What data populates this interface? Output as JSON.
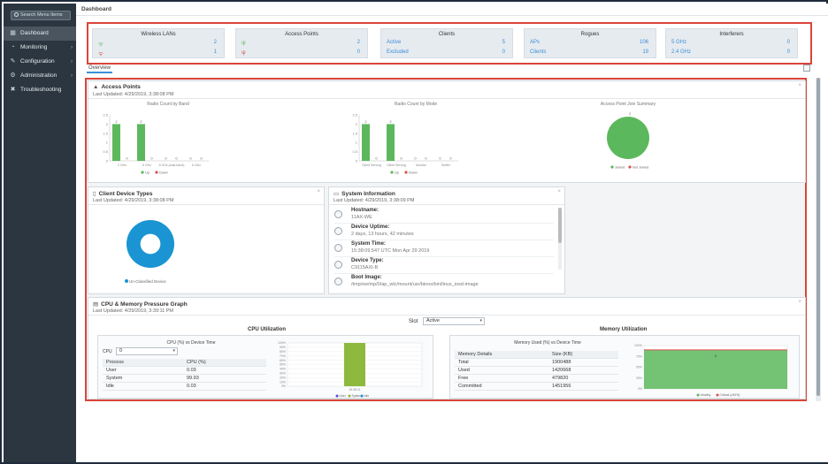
{
  "sidebar": {
    "search_placeholder": "Search Menu Items",
    "items": [
      {
        "label": "Dashboard",
        "icon": "dashboard-icon",
        "active": true
      },
      {
        "label": "Monitoring",
        "icon": "monitoring-icon",
        "chevron": "›"
      },
      {
        "label": "Configuration",
        "icon": "configuration-icon",
        "chevron": "›"
      },
      {
        "label": "Administration",
        "icon": "administration-icon",
        "chevron": "›"
      },
      {
        "label": "Troubleshooting",
        "icon": "troubleshooting-icon"
      }
    ]
  },
  "header": {
    "title": "Dashboard"
  },
  "summary": [
    {
      "title": "Wireless LANs",
      "rows": [
        {
          "label": "",
          "value": "2",
          "icon": "wifi-up-icon"
        },
        {
          "label": "",
          "value": "1",
          "icon": "wifi-down-icon"
        }
      ]
    },
    {
      "title": "Access Points",
      "rows": [
        {
          "label": "",
          "value": "2",
          "icon": "ap-up-icon"
        },
        {
          "label": "",
          "value": "0",
          "icon": "ap-down-icon"
        }
      ]
    },
    {
      "title": "Clients",
      "rows": [
        {
          "label": "Active",
          "value": "5"
        },
        {
          "label": "Excluded",
          "value": "0"
        }
      ]
    },
    {
      "title": "Rogues",
      "rows": [
        {
          "label": "APs",
          "value": "106"
        },
        {
          "label": "Clients",
          "value": "19"
        }
      ]
    },
    {
      "title": "Interferers",
      "rows": [
        {
          "label": "5 GHz",
          "value": "0"
        },
        {
          "label": "2.4 GHz",
          "value": "0"
        }
      ]
    }
  ],
  "tabs": [
    {
      "label": "Overview"
    }
  ],
  "access_points": {
    "title": "Access Points",
    "updated": "Last Updated: 4/29/2019, 3:38:08 PM",
    "radio_by_band": {
      "title": "Radio Count by Band"
    },
    "radio_by_mode": {
      "title": "Radio Count by Mode"
    },
    "join_summary": {
      "title": "Access Point Join Summary",
      "legend": [
        "Joined",
        "Not Joined"
      ]
    }
  },
  "client_types": {
    "title": "Client Device Types",
    "updated": "Last Updated: 4/29/2019, 3:38:08 PM",
    "legend": "Un-Classified Device"
  },
  "system_info": {
    "title": "System Information",
    "updated": "Last Updated: 4/29/2019, 3:38:09 PM",
    "rows": [
      {
        "label": "Hostname:",
        "value": "11AX-WE"
      },
      {
        "label": "Device Uptime:",
        "value": "2 days, 13 hours, 42 minutes"
      },
      {
        "label": "System Time:",
        "value": "15:38:09.547 UTC Mon Apr 29 2019"
      },
      {
        "label": "Device Type:",
        "value": "C9115AXI-B"
      },
      {
        "label": "Boot Image:",
        "value": "/tmp/sw/mp/0/ap_wlc/mount/usr/binos/bin/linux_iosd-image"
      }
    ]
  },
  "cpu_mem": {
    "title": "CPU & Memory Pressure Graph",
    "updated": "Last Updated: 4/29/2019, 3:39:11 PM",
    "slot_label": "Slot",
    "slot_value": "Active",
    "cpu": {
      "heading": "CPU Utilization",
      "chart_title": "CPU (%) vs Device Time",
      "cpu_label": "CPU",
      "cpu_value": "0",
      "columns": [
        "Process",
        "CPU (%)"
      ],
      "rows": [
        [
          "User",
          "0.03"
        ],
        [
          "System",
          "99.93"
        ],
        [
          "Idle",
          "0.03"
        ]
      ],
      "x_tick": "15:38:11",
      "legend": [
        "User",
        "System",
        "Idle"
      ]
    },
    "mem": {
      "heading": "Memory Utilization",
      "chart_title": "Memory Used (%) vs Device Time",
      "columns": [
        "Memory Details",
        "Size (KB)"
      ],
      "rows": [
        [
          "Total",
          "1900488"
        ],
        [
          "Used",
          "1420668"
        ],
        [
          "Free",
          "479820"
        ],
        [
          "Committed",
          "1451956"
        ]
      ],
      "legend": [
        "Healthy",
        "Critical (≥90%)"
      ]
    }
  },
  "chart_data": [
    {
      "type": "bar",
      "title": "Radio Count by Band",
      "categories": [
        "2 GHz",
        "5 GHz",
        "5 GHz (dual-band)",
        "6 GHz"
      ],
      "series": [
        {
          "name": "Up",
          "values": [
            2,
            2,
            0,
            0
          ],
          "color": "#5cb85c"
        },
        {
          "name": "Down",
          "values": [
            0,
            0,
            0,
            0
          ],
          "color": "#d9534f"
        }
      ],
      "ylim": [
        0,
        2.5
      ],
      "yticks": [
        0,
        0.5,
        1,
        1.5,
        2,
        2.5
      ]
    },
    {
      "type": "bar",
      "title": "Radio Count by Mode",
      "categories": [
        "Client Serving",
        "Client Serving",
        "Monitor",
        "Sniffer"
      ],
      "series": [
        {
          "name": "Up",
          "values": [
            2,
            2,
            0,
            0
          ],
          "color": "#5cb85c"
        },
        {
          "name": "Down",
          "values": [
            0,
            0,
            0,
            0
          ],
          "color": "#d9534f"
        }
      ],
      "ylim": [
        0,
        2.5
      ],
      "yticks": [
        0,
        0.5,
        1,
        1.5,
        2,
        2.5
      ]
    },
    {
      "type": "pie",
      "title": "Access Point Join Summary",
      "labels": [
        "Joined",
        "Not Joined"
      ],
      "values": [
        2,
        0
      ],
      "colors": [
        "#5cb85c",
        "#d9534f"
      ]
    },
    {
      "type": "pie",
      "title": "Client Device Types",
      "labels": [
        "Un-Classified Device"
      ],
      "values": [
        5
      ],
      "colors": [
        "#1a94d2"
      ],
      "donut": true
    },
    {
      "type": "bar",
      "title": "CPU (%) vs Device Time",
      "categories": [
        "15:38:11"
      ],
      "series": [
        {
          "name": "System",
          "values": [
            99.93
          ],
          "color": "#8db93e"
        }
      ],
      "ylim": [
        0,
        100
      ],
      "yticks": [
        0,
        10,
        20,
        30,
        40,
        50,
        60,
        70,
        80,
        90,
        100
      ]
    },
    {
      "type": "area",
      "title": "Memory Used (%) vs Device Time",
      "series": [
        {
          "name": "Healthy",
          "values": [
            74.7
          ],
          "color": "#5cb85c"
        },
        {
          "name": "Critical (≥90%)",
          "values": [
            90
          ],
          "color": "#d9534f"
        }
      ],
      "ylim": [
        0,
        100
      ],
      "yticks": [
        0,
        25,
        50,
        75,
        100
      ],
      "annotation": "0"
    }
  ]
}
